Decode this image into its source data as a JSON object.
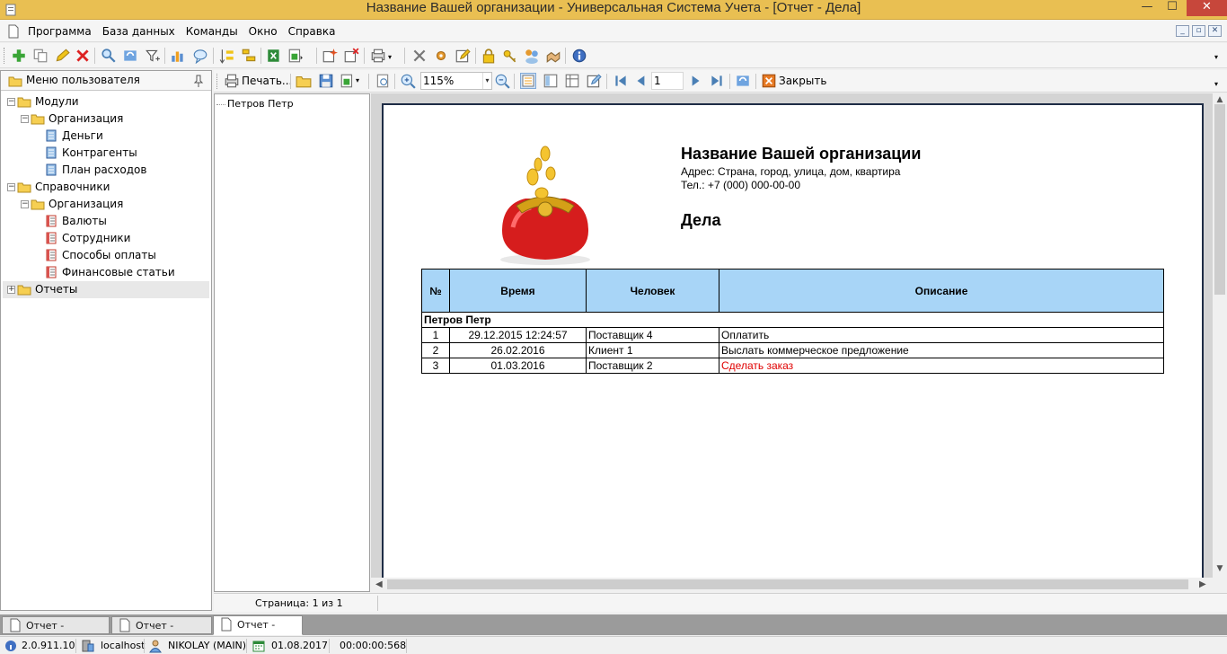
{
  "window": {
    "title": "Название Вашей организации - Универсальная Система Учета - [Отчет - Дела]",
    "minimize": "—",
    "maximize": "☐",
    "close": "✕"
  },
  "menu": {
    "items": [
      "Программа",
      "База данных",
      "Команды",
      "Окно",
      "Справка"
    ]
  },
  "left_panel": {
    "title": "Меню пользователя",
    "tree": [
      {
        "label": "Модули",
        "expanded": true
      },
      {
        "label": "Организация",
        "expanded": true
      },
      {
        "label": "Деньги"
      },
      {
        "label": "Контрагенты"
      },
      {
        "label": "План расходов"
      },
      {
        "label": "Справочники",
        "expanded": true
      },
      {
        "label": "Организация",
        "expanded": true
      },
      {
        "label": "Валюты"
      },
      {
        "label": "Сотрудники"
      },
      {
        "label": "Способы оплаты"
      },
      {
        "label": "Финансовые статьи"
      },
      {
        "label": "Отчеты",
        "expanded": false
      }
    ]
  },
  "report_toolbar": {
    "print_label": "Печать...",
    "zoom": "115%",
    "page_number": "1",
    "close_label": "Закрыть"
  },
  "report_tree": {
    "node": "Петров Петр"
  },
  "report": {
    "org_name": "Название Вашей организации",
    "address": "Адрес: Страна, город, улица, дом, квартира",
    "phone": "Тел.: +7 (000) 000-00-00",
    "title": "Дела",
    "columns": [
      "№",
      "Время",
      "Человек",
      "Описание"
    ],
    "group": "Петров Петр",
    "rows": [
      {
        "n": "1",
        "time": "29.12.2015 12:24:57",
        "person": "Поставщик 4",
        "desc": "Оплатить"
      },
      {
        "n": "2",
        "time": "26.02.2016",
        "person": "Клиент 1",
        "desc": "Выслать коммерческое предложение"
      },
      {
        "n": "3",
        "time": "01.03.2016",
        "person": "Поставщик 2",
        "desc": "Сделать заказ"
      }
    ]
  },
  "report_status": {
    "page": "Страница: 1 из 1"
  },
  "tabs": [
    "Отчет - Расходы",
    "Отчет - Деньги",
    "Отчет - Дела"
  ],
  "status": {
    "version": "2.0.911.10",
    "server": "localhost",
    "user": "NIKOLAY (MAIN)",
    "date": "01.08.2017",
    "timer": "00:00:00:568"
  },
  "colors": {
    "titlebar": "#e9bf52",
    "table_header": "#a8d5f7",
    "overdue_text": "#e00000",
    "page_border": "#1e2c45"
  }
}
